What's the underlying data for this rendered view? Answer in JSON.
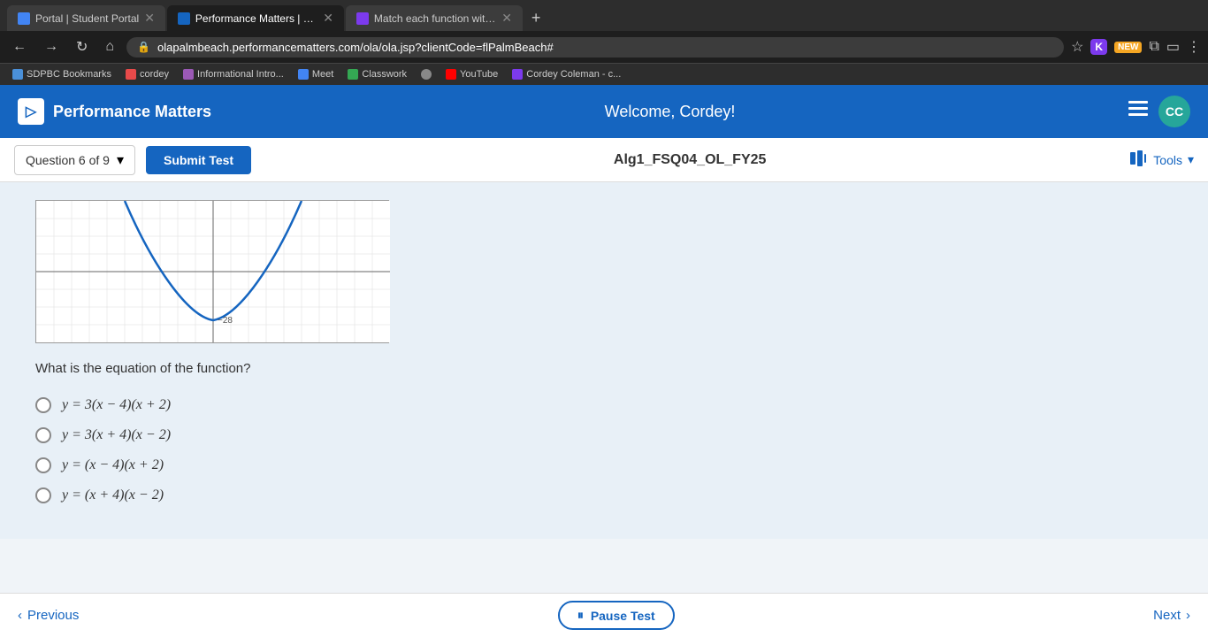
{
  "browser": {
    "tabs": [
      {
        "id": "tab1",
        "title": "Portal | Student Portal",
        "favicon_color": "#4285f4",
        "active": false
      },
      {
        "id": "tab2",
        "title": "Performance Matters | OLA",
        "favicon_color": "#1565c0",
        "active": true
      },
      {
        "id": "tab3",
        "title": "Match each function with the c...",
        "favicon_color": "#7c3aed",
        "active": false
      }
    ],
    "address": "olapalmbeach.performancematters.com/ola/ola.jsp?clientCode=flPalmBeach#"
  },
  "bookmarks": [
    {
      "label": "SDPBC Bookmarks",
      "color": "#4a90d9"
    },
    {
      "label": "cordey",
      "color": "#e84a4a"
    },
    {
      "label": "Informational Intro...",
      "color": "#9b59b6"
    },
    {
      "label": "Meet",
      "color": "#4285f4"
    },
    {
      "label": "Classwork",
      "color": "#34a853"
    },
    {
      "label": "",
      "color": "#888"
    },
    {
      "label": "YouTube",
      "color": "#ff0000"
    },
    {
      "label": "Cordey Coleman - c...",
      "color": "#7c3aed"
    }
  ],
  "header": {
    "logo_text": "Performance Matters",
    "welcome_text": "Welcome, Cordey!",
    "avatar_initials": "CC"
  },
  "toolbar": {
    "question_label": "Question 6 of 9",
    "submit_label": "Submit Test",
    "test_title": "Alg1_FSQ04_OL_FY25",
    "tools_label": "Tools"
  },
  "question": {
    "prompt": "What is the equation of the function?",
    "options": [
      {
        "id": "a",
        "math": "y = 3(x − 4)(x + 2)"
      },
      {
        "id": "b",
        "math": "y = 3(x + 4)(x − 2)"
      },
      {
        "id": "c",
        "math": "y = (x − 4)(x + 2)"
      },
      {
        "id": "d",
        "math": "y = (x + 4)(x − 2)"
      }
    ]
  },
  "footer": {
    "previous_label": "Previous",
    "pause_label": "Pause Test",
    "next_label": "Next"
  },
  "icons": {
    "chevron_down": "▾",
    "arrow_left": "‹",
    "arrow_right": "›",
    "pause": "⏸",
    "bars": "▮▮▮"
  }
}
